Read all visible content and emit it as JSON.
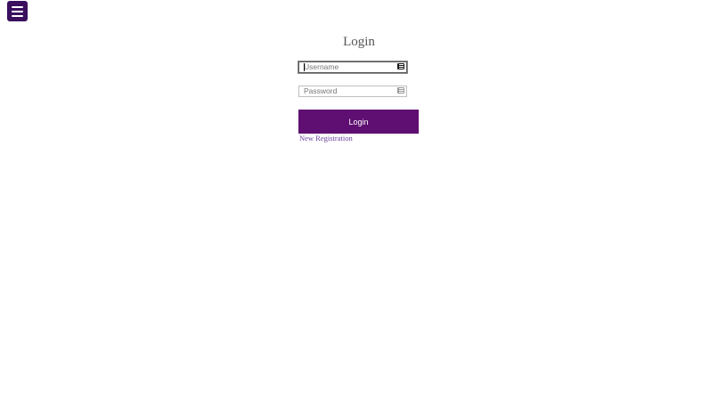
{
  "menu": {
    "icon": "hamburger-menu-icon",
    "bg_color": "#3a0f5e"
  },
  "form": {
    "title": "Login",
    "username": {
      "placeholder": "Username",
      "value": "",
      "icon": "key-icon"
    },
    "password": {
      "placeholder": "Password",
      "value": "",
      "icon": "key-icon"
    },
    "login_button_label": "Login",
    "register_link_label": "New Registration"
  },
  "colors": {
    "accent": "#5f0f72",
    "link": "#6a3fa0",
    "title": "#555555"
  }
}
